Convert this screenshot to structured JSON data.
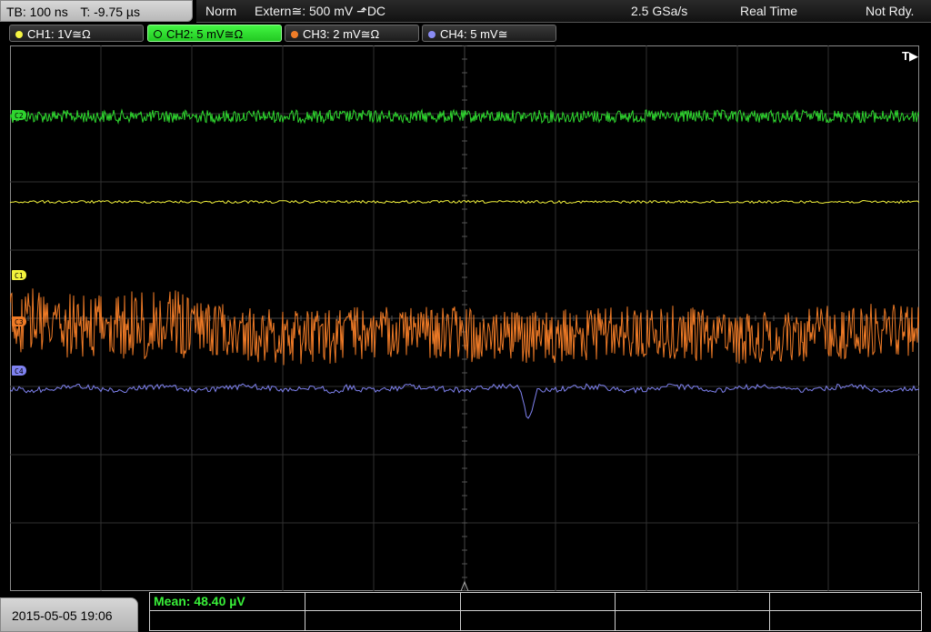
{
  "topbar": {
    "timebase": "TB: 100 ns",
    "trigger_time": "T: -9.75 µs",
    "mode": "Norm",
    "trigger_source": "Extern≅: 500 mV ⬏DC",
    "sample_rate": "2.5 GSa/s",
    "acq_mode": "Real Time",
    "status": "Not Rdy."
  },
  "channels": [
    {
      "label": "CH1: 1V≅Ω",
      "color": "#f5f542",
      "active": false
    },
    {
      "label": "CH2: 5 mV≅Ω",
      "color": "#3ee63e",
      "active": true
    },
    {
      "label": "CH3: 2 mV≅Ω",
      "color": "#f07d28",
      "active": false
    },
    {
      "label": "CH4: 5 mV≅",
      "color": "#8a8cf5",
      "active": false
    }
  ],
  "trace_labels": {
    "c1": "C1",
    "c2": "C2",
    "c3": "C3",
    "c4": "C4"
  },
  "trigger_marker": "T▶",
  "footer": {
    "datetime": "2015-05-05 19:06",
    "measurement": "Mean: 48.40 µV"
  },
  "colors": {
    "ch1": "#f2f23c",
    "ch2": "#2fd62f",
    "ch3": "#ee7a26",
    "ch4": "#7f82f0",
    "grid": "#2f2f2f",
    "text": "#ffffff"
  }
}
